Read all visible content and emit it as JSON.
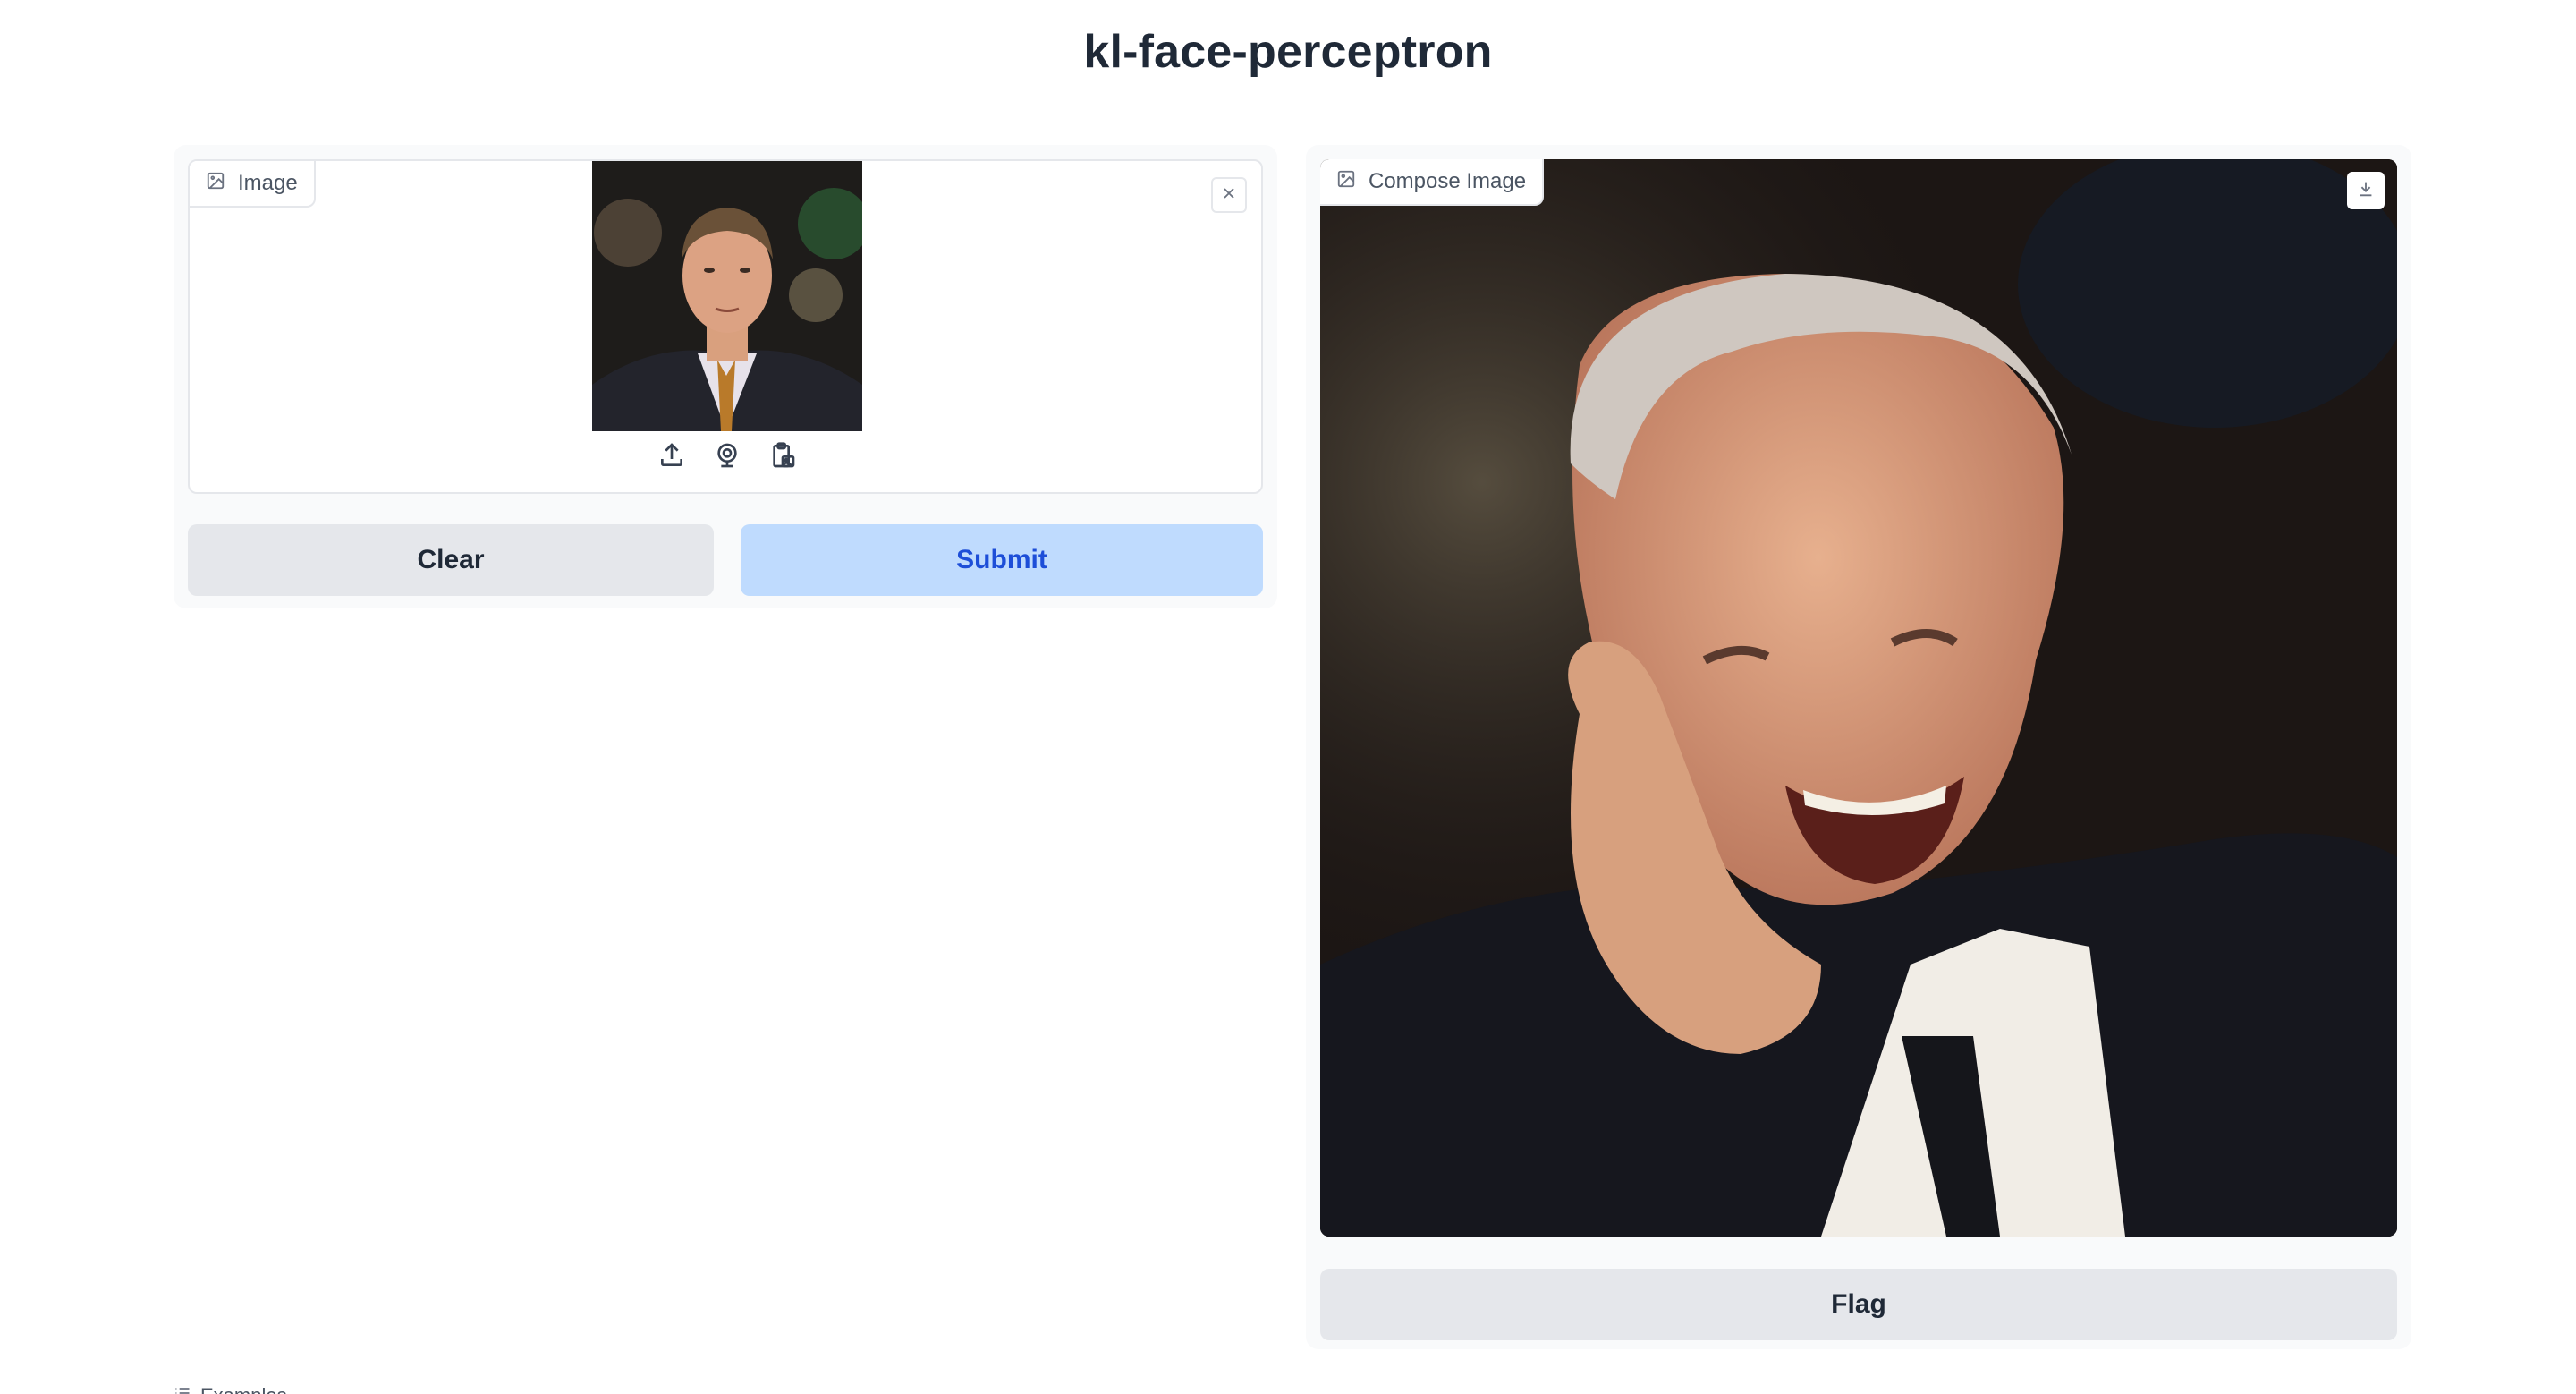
{
  "app": {
    "title": "kl-face-perceptron"
  },
  "input": {
    "label": "Image",
    "sources": [
      "upload-icon",
      "webcam-icon",
      "clipboard-icon"
    ]
  },
  "buttons": {
    "clear": "Clear",
    "submit": "Submit",
    "flag": "Flag"
  },
  "output": {
    "label": "Compose Image"
  },
  "examples": {
    "label": "Examples"
  },
  "colors": {
    "submit_bg": "#bfdbfe",
    "submit_text": "#1d4ed8",
    "neutral_button": "#e5e7eb",
    "panel_bg": "#f9fafb"
  }
}
